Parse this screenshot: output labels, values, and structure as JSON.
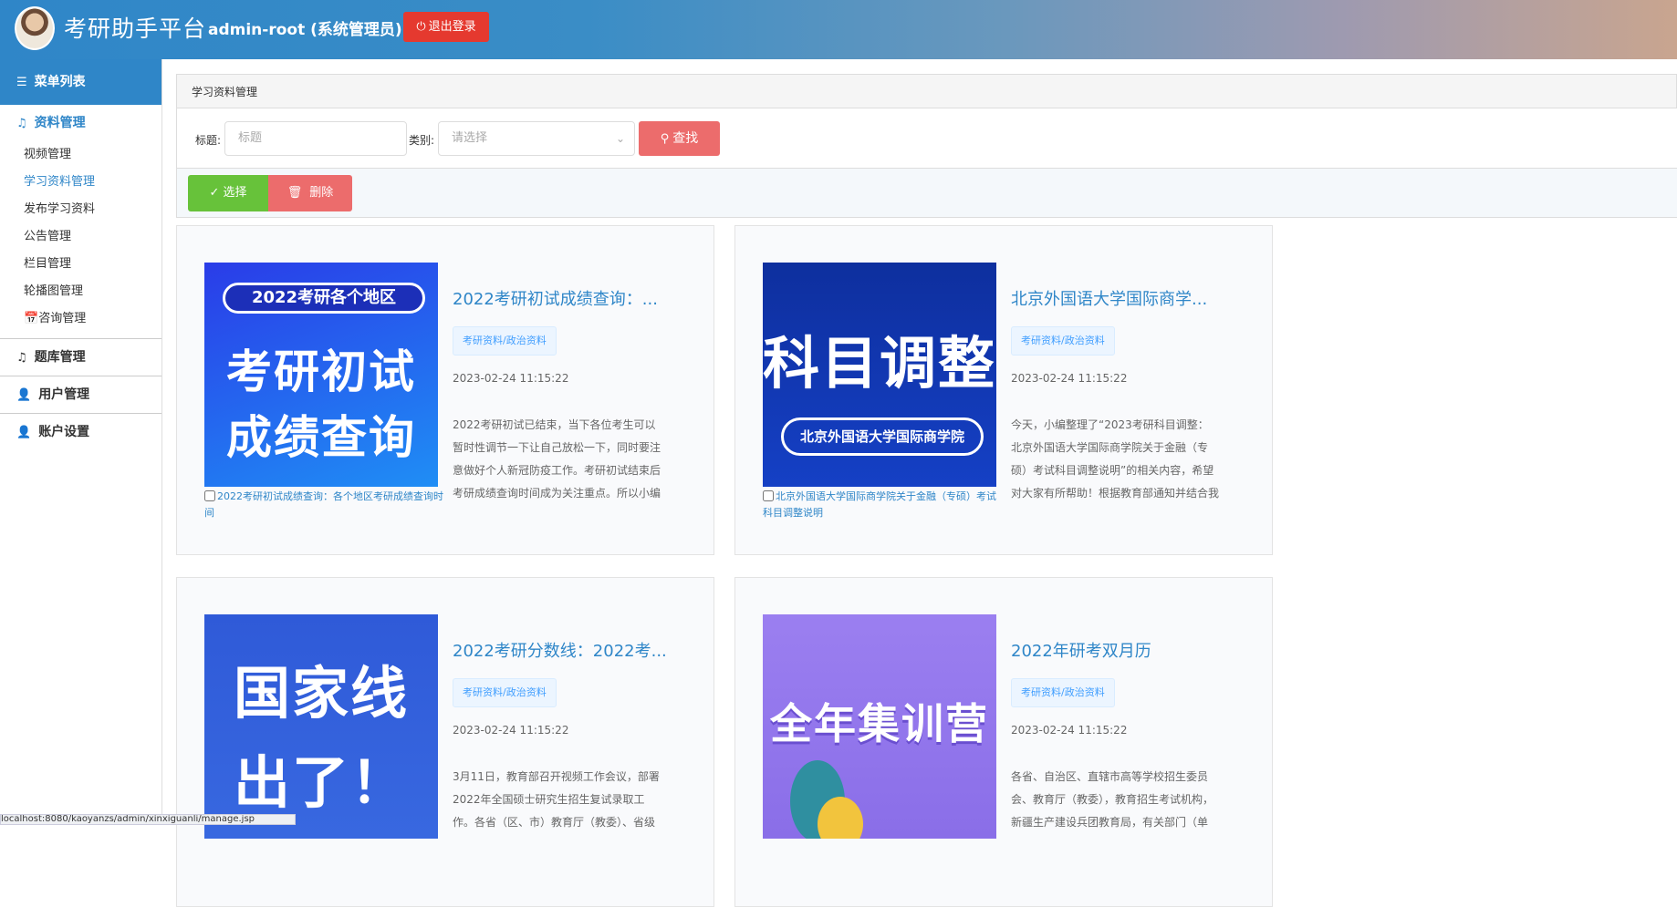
{
  "header": {
    "app_title": "考研助手平台",
    "user": "admin-root (系统管理员)",
    "logout": "退出登录"
  },
  "sidebar": {
    "menu_title": "菜单列表",
    "group_active": "资料管理",
    "items": [
      "视频管理",
      "学习资料管理",
      "发布学习资料",
      "公告管理",
      "栏目管理",
      "轮播图管理",
      "咨询管理"
    ],
    "groups": [
      "题库管理",
      "用户管理",
      "账户设置"
    ]
  },
  "panel_title": "学习资料管理",
  "filter": {
    "title_label": "标题:",
    "title_placeholder": "标题",
    "category_label": "类别:",
    "category_placeholder": "请选择",
    "search": "查找"
  },
  "toolbar": {
    "select": "选择",
    "delete": "删除"
  },
  "cards": [
    {
      "title": "2022考研初试成绩查询：...",
      "caption": "2022考研初试成绩查询：各个地区考研成绩查询时间",
      "tag": "考研资料/政治资料",
      "date": "2023-02-24 11:15:22",
      "desc": "2022考研初试已结束，当下各位考生可以暂时性调节一下让自己放松一下，同时要注意做好个人新冠防疫工作。考研初试结束后考研成绩查询时间成为关注重点。所以小编",
      "img_band": "2022考研各个地区",
      "img_line1": "考研初试",
      "img_line2": "成绩查询"
    },
    {
      "title": "北京外国语大学国际商学...",
      "caption": "北京外国语大学国际商学院关于金融（专硕）考试科目调整说明",
      "tag": "考研资料/政治资料",
      "date": "2023-02-24 11:15:22",
      "desc": "今天，小编整理了“2023考研科目调整：北京外国语大学国际商学院关于金融（专硕）考试科目调整说明”的相关内容，希望对大家有所帮助！根据教育部通知并结合我院实",
      "img_band": "北京外国语大学国际商学院",
      "img_line1": "科目调整"
    },
    {
      "title": "2022考研分数线：2022考...",
      "tag": "考研资料/政治资料",
      "date": "2023-02-24 11:15:22",
      "desc": "3月11日，教育部召开视频工作会议，部署2022年全国硕士研究生招生复试录取工作。各省（区、市）教育厅（教委）、省级",
      "img_line1": "国家线",
      "img_line2": "出了！"
    },
    {
      "title": "2022年研考双月历",
      "tag": "考研资料/政治资料",
      "date": "2023-02-24 11:15:22",
      "desc": "各省、自治区、直辖市高等学校招生委员会、教育厅（教委），教育招生考试机构，新疆生产建设兵团教育局，有关部门（单",
      "img_line1": "全年集训营"
    }
  ],
  "status_url": "localhost:8080/kaoyanzs/admin/xinxiguanli/manage.jsp"
}
